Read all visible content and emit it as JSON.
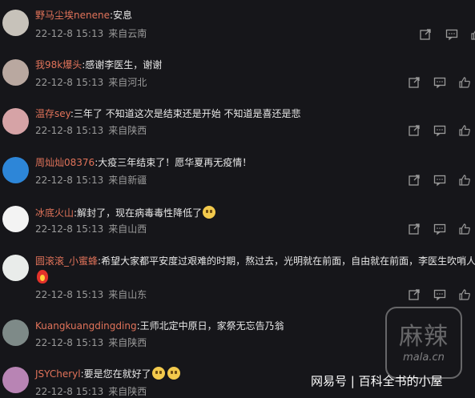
{
  "comments": [
    {
      "user": "野马尘埃nenene",
      "text": "安息",
      "date": "22-12-8 15:13",
      "location": "来自云南",
      "avatar_color": "#c7c2ba",
      "emoji_count": 0
    },
    {
      "user": "我98k爆头",
      "text": "感谢李医生，谢谢",
      "date": "22-12-8 15:13",
      "location": "来自河北",
      "avatar_color": "#b9a8a0",
      "emoji_count": 0
    },
    {
      "user": "温存sey",
      "text": "三年了 不知道这次是结束还是开始 不知道是喜还是悲",
      "date": "22-12-8 15:13",
      "location": "来自陕西",
      "avatar_color": "#d6a3a6",
      "emoji_count": 0
    },
    {
      "user": "周灿灿08376",
      "text": "大疫三年结束了！愿华夏再无疫情！",
      "date": "22-12-8 15:13",
      "location": "来自新疆",
      "avatar_color": "#2d86d8",
      "emoji_count": 0
    },
    {
      "user": "冰底火山",
      "text": "解封了，现在病毒毒性降低了",
      "date": "22-12-8 15:13",
      "location": "来自山西",
      "avatar_color": "#f3f3f3",
      "emoji_count": 1
    },
    {
      "user": "圆滚滚_小蜜蜂",
      "text": "希望大家都平安度过艰难的时期，熬过去，光明就在前面，自由就在前面，李医生吹哨人",
      "date": "22-12-8 15:13",
      "location": "来自山东",
      "avatar_color": "#e9ecea",
      "emoji_count": 0
    },
    {
      "user": "Kuangkuangdingding",
      "text": "王师北定中原日，家祭无忘告乃翁",
      "date": "22-12-8 15:13",
      "location": "来自陕西",
      "avatar_color": "#7e8a88",
      "emoji_count": 0
    },
    {
      "user": "JSYCheryl",
      "text": "要是您在就好了",
      "date": "22-12-8 15:13",
      "location": "来自陕西",
      "avatar_color": "#b884b4",
      "emoji_count": 2
    }
  ],
  "watermark": {
    "title": "麻辣",
    "subtitle": "mala.cn"
  },
  "source_label": "网易号 | 百科全书的小屋",
  "colors": {
    "username": "#e1735a",
    "background": "#16161a",
    "meta": "#9a9a9a"
  }
}
